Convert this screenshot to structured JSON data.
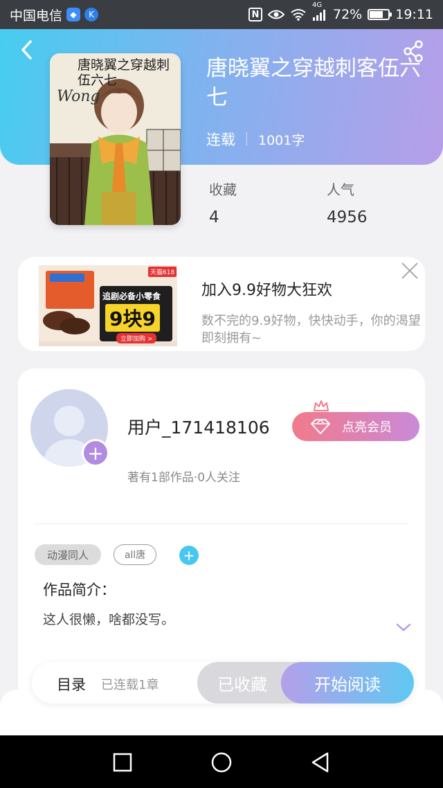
{
  "status_bar": {
    "carrier": "中国电信",
    "badge_shield": "◆",
    "badge_k": "K",
    "nfc": "N",
    "net": "4G",
    "battery": "72%",
    "battery_level": 0.72,
    "time": "19:11",
    "icons": [
      "shield-icon",
      "k-app-icon",
      "nfc-icon",
      "eye-icon",
      "wifi-icon",
      "signal-icon",
      "battery-icon"
    ]
  },
  "header": {
    "back_icon": "chevron-left-icon",
    "share_icon": "share-icon"
  },
  "book": {
    "title": "唐晓翼之穿越刺客伍六七",
    "status": "连载",
    "word_count": "1001字",
    "cover_title": "唐晓翼之穿越刺伍六七",
    "cover_script": "Wong",
    "stats": [
      {
        "label": "收藏",
        "value": "4"
      },
      {
        "label": "人气",
        "value": "4956"
      }
    ]
  },
  "ad": {
    "title": "加入9.9好物大狂欢",
    "description": "数不完的9.9好物，快快动手，你的渴望即刻拥有~",
    "image_tag": "天猫618",
    "image_banner": "追剧必备小零食",
    "image_price": "9块9",
    "image_button": "立即加购 >",
    "close_icon": "close-icon"
  },
  "author": {
    "username": "用户_171418106",
    "meta": "著有1部作品·0人关注",
    "vip_label": "点亮会员",
    "tags": [
      "动漫同人",
      "all唐"
    ],
    "intro_title": "作品简介：",
    "intro_text": "这人很懒，啥都没写。"
  },
  "bottom_bar": {
    "toc_label": "目录",
    "toc_sub": "已连载1章",
    "favorite_label": "已收藏",
    "read_label": "开始阅读"
  },
  "colors": {
    "header_start": "#46cdf0",
    "header_end": "#b79ee9",
    "vip_start": "#f27a8a",
    "vip_end": "#c98ad9",
    "accent_blue": "#48c7ef",
    "accent_purple": "#b18ce0"
  }
}
